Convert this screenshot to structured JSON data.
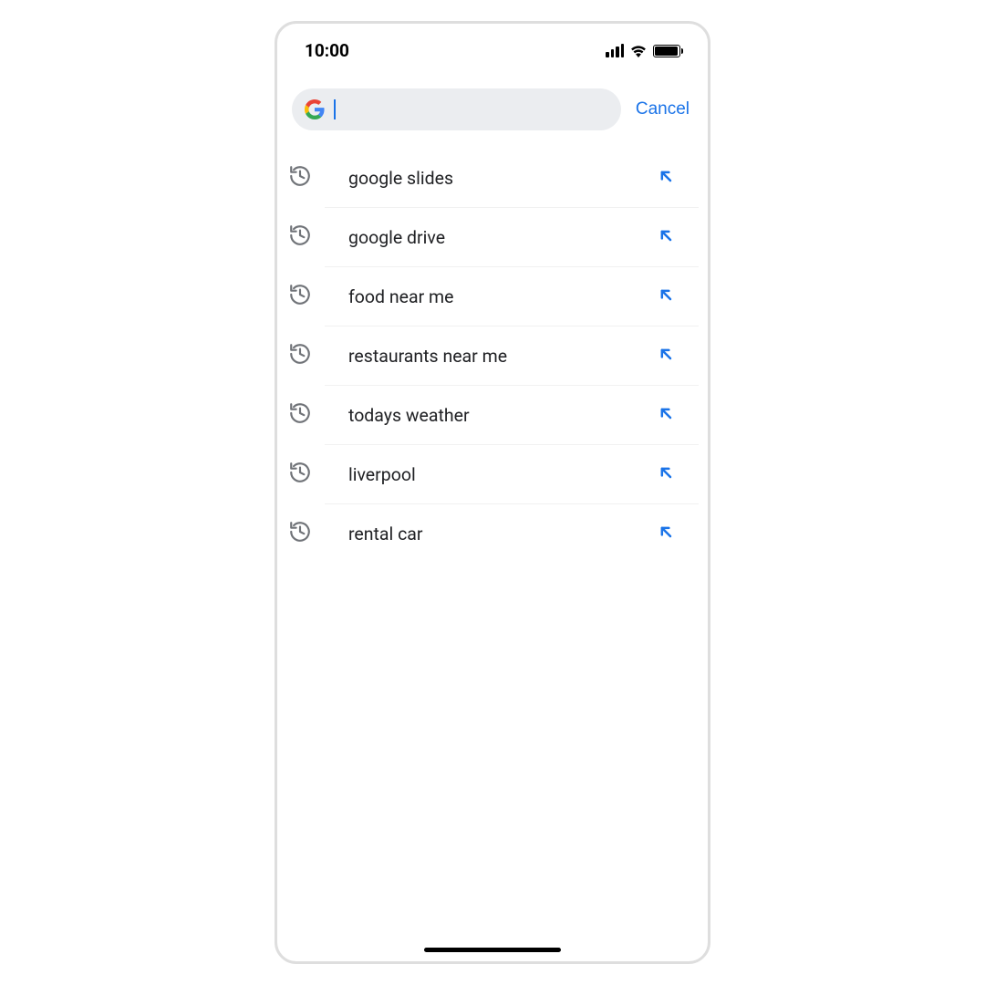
{
  "status": {
    "time": "10:00"
  },
  "search": {
    "value": "",
    "placeholder": "",
    "cancel_label": "Cancel"
  },
  "suggestions": [
    {
      "label": "google slides",
      "icon": "history-icon",
      "action": "insert"
    },
    {
      "label": "google drive",
      "icon": "history-icon",
      "action": "insert"
    },
    {
      "label": "food near me",
      "icon": "history-icon",
      "action": "insert"
    },
    {
      "label": "restaurants near me",
      "icon": "history-icon",
      "action": "insert"
    },
    {
      "label": "todays weather",
      "icon": "history-icon",
      "action": "insert"
    },
    {
      "label": "liverpool",
      "icon": "history-icon",
      "action": "insert"
    },
    {
      "label": "rental car",
      "icon": "history-icon",
      "action": "insert"
    }
  ],
  "colors": {
    "accent": "#1a73e8",
    "google_blue": "#4285F4",
    "google_red": "#EA4335",
    "google_yellow": "#FBBC05",
    "google_green": "#34A853"
  }
}
